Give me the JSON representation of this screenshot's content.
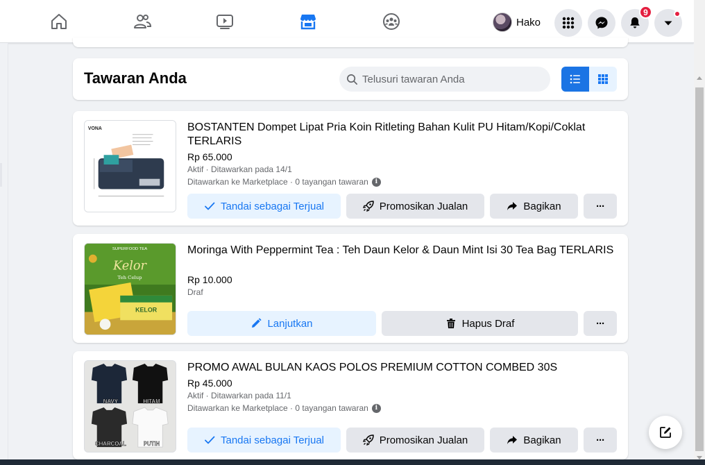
{
  "nav": {
    "profile_name": "Hako",
    "notification_count": "9",
    "tabs": [
      "home-icon",
      "friends-icon",
      "watch-icon",
      "marketplace-icon",
      "groups-icon"
    ],
    "accent_color": "#1877f2"
  },
  "header": {
    "title": "Tawaran Anda",
    "search_placeholder": "Telusuri tawaran Anda",
    "active_view": "list"
  },
  "listings": [
    {
      "title": "BOSTANTEN Dompet Lipat Pria Koin Ritleting Bahan Kulit PU Hitam/Kopi/Coklat TERLARIS",
      "price": "Rp 65.000",
      "status": "Aktif · Ditawarkan pada 14/1",
      "stats": "Ditawarkan ke Marketplace · 0 tayangan tawaran",
      "thumb_brand": "VONA",
      "primary_label": "Tandai sebagai Terjual",
      "secondary_label": "Promosikan Jualan",
      "share_label": "Bagikan",
      "more_label": "···"
    },
    {
      "title": "Moringa With Peppermint Tea : Teh Daun Kelor & Daun Mint Isi 30 Tea Bag TERLARIS",
      "price": "Rp 10.000",
      "status": "Draf",
      "thumb_top": "SUPERFOOD TEA",
      "thumb_script": "Kelor",
      "thumb_sub": "Teh Celup",
      "thumb_box": "KELOR",
      "primary_label": "Lanjutkan",
      "secondary_label": "Hapus Draf",
      "more_label": "···"
    },
    {
      "title": "PROMO AWAL BULAN KAOS POLOS PREMIUM COTTON COMBED 30S",
      "price": "Rp 45.000",
      "status": "Aktif · Ditawarkan pada 11/1",
      "stats": "Ditawarkan ke Marketplace · 0 tayangan tawaran",
      "thumb_labels": [
        "NAVY",
        "HITAM",
        "CHARCOAL",
        "PUTIH"
      ],
      "primary_label": "Tandai sebagai Terjual",
      "secondary_label": "Promosikan Jualan",
      "share_label": "Bagikan",
      "more_label": "···"
    }
  ]
}
